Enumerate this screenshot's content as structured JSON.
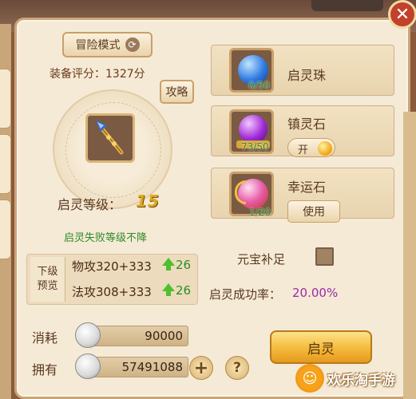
{
  "header": {
    "close_symbol": "✕"
  },
  "left_panel": {
    "mode_label": "冒险模式",
    "mode_icon": "swap-icon",
    "score_label": "装备评分：",
    "score_value": "1327分",
    "guide_button": "攻略",
    "equipment_icon": "staff-icon",
    "level_label": "启灵等级：",
    "level_value": "15",
    "fail_note": "启灵失败等级不降",
    "preview": {
      "tag_line1": "下级",
      "tag_line2": "预览",
      "rows": [
        {
          "text": "物攻320+333",
          "gain": "26"
        },
        {
          "text": "法攻308+333",
          "gain": "26"
        }
      ]
    }
  },
  "items": [
    {
      "name": "启灵珠",
      "count": "0/50",
      "icon": "blue-orb-icon"
    },
    {
      "name": "镇灵石",
      "count": "73/50",
      "icon": "purple-orb-icon",
      "toggle_label": "开"
    },
    {
      "name": "幸运石",
      "count": "1/20",
      "icon": "luck-stone-icon",
      "button_label": "使用"
    }
  ],
  "yuanbao": {
    "label": "元宝补足",
    "checked": false
  },
  "success": {
    "label": "启灵成功率：",
    "value": "20.00%"
  },
  "resources": {
    "cost_label": "消耗",
    "cost_value": "90000",
    "own_label": "拥有",
    "own_value": "57491088",
    "plus_symbol": "+",
    "help_symbol": "?"
  },
  "main_button": {
    "label": "启灵"
  },
  "watermark": {
    "logo_glyph": "☺",
    "text": "欢乐淘手游"
  },
  "colors": {
    "panel_bg": "#f5ead6",
    "level_gold": "#e0a91a",
    "success_purple": "#9a2aa8",
    "gain_green": "#2f8a2a",
    "close_red": "#c2412c"
  }
}
